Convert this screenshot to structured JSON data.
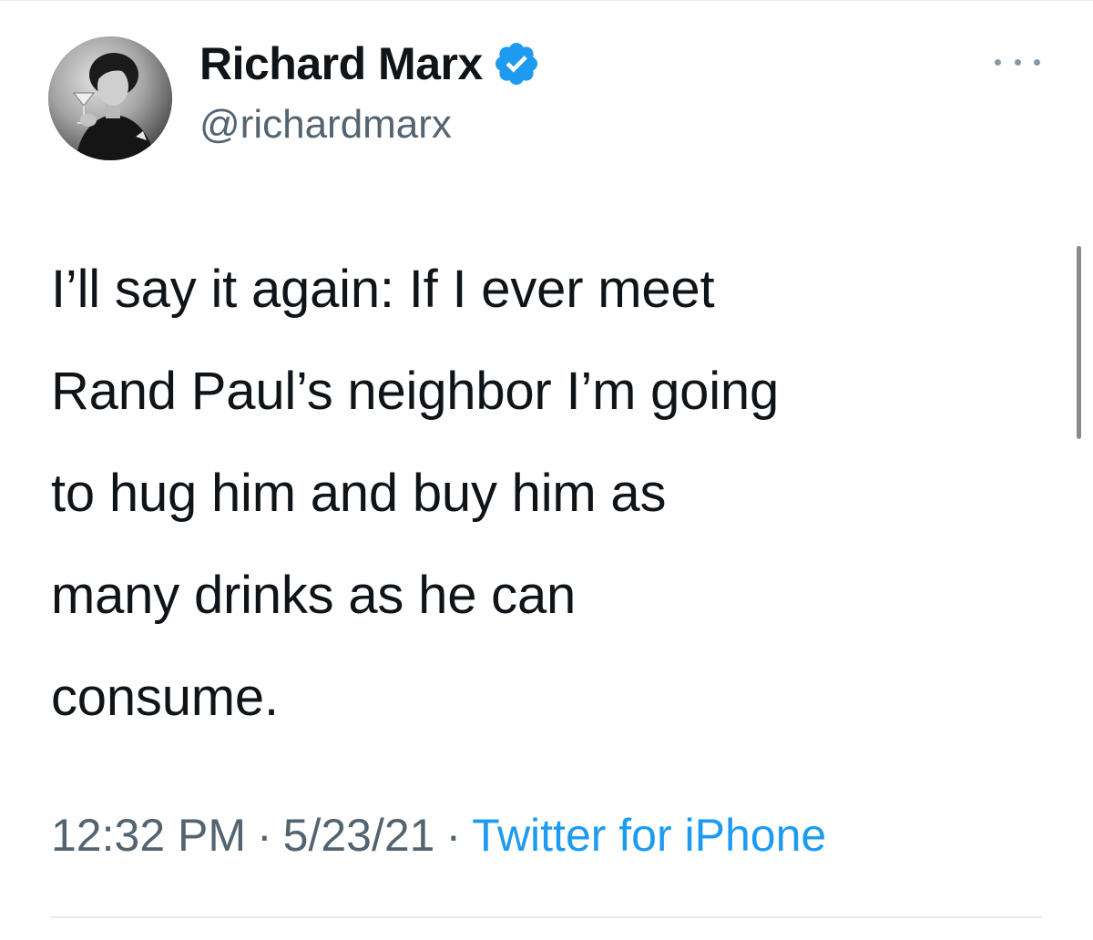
{
  "tweet": {
    "display_name": "Richard Marx",
    "verified": true,
    "handle": "@richardmarx",
    "text": "I’ll say it again: If I ever meet\nRand Paul’s neighbor I’m going\nto hug him and buy him as\nmany drinks as he can\nconsume.",
    "time": "12:32 PM",
    "separator": "·",
    "date": "5/23/21",
    "source": "Twitter for iPhone"
  },
  "icons": {
    "verified": "verified-badge-icon",
    "more": "more-options-icon"
  },
  "colors": {
    "verified_blue": "#1d9bf0",
    "text_primary": "#0f1419",
    "text_secondary": "#536471",
    "link": "#1d9bf0"
  }
}
